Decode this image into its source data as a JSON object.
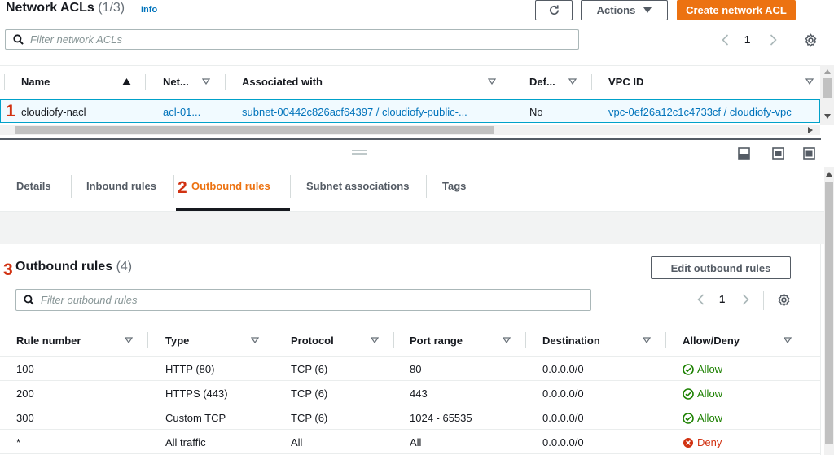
{
  "header": {
    "title": "Network ACLs",
    "count": "(1/3)",
    "info": "Info",
    "actions_label": "Actions",
    "create_label": "Create network ACL"
  },
  "acl_search": {
    "placeholder": "Filter network ACLs"
  },
  "acl_pager": {
    "page": "1"
  },
  "acl_table": {
    "columns": [
      "Name",
      "Net...",
      "Associated with",
      "Def...",
      "VPC ID"
    ],
    "rows": [
      {
        "name": "cloudiofy-nacl",
        "net": "acl-01...",
        "associated": "subnet-00442c826acf64397 / cloudiofy-public-...",
        "default": "No",
        "vpc": "vpc-0ef26a12c1c4733cf / cloudiofy-vpc"
      }
    ]
  },
  "annotations": {
    "one": "1",
    "two": "2",
    "three": "3"
  },
  "tabs": [
    "Details",
    "Inbound rules",
    "Outbound rules",
    "Subnet associations",
    "Tags"
  ],
  "outbound": {
    "title": "Outbound rules",
    "count": "(4)",
    "edit_label": "Edit outbound rules",
    "search_placeholder": "Filter outbound rules",
    "page": "1",
    "columns": [
      "Rule number",
      "Type",
      "Protocol",
      "Port range",
      "Destination",
      "Allow/Deny"
    ],
    "rows": [
      {
        "rule": "100",
        "type": "HTTP (80)",
        "protocol": "TCP (6)",
        "port": "80",
        "dest": "0.0.0.0/0",
        "action": "Allow"
      },
      {
        "rule": "200",
        "type": "HTTPS (443)",
        "protocol": "TCP (6)",
        "port": "443",
        "dest": "0.0.0.0/0",
        "action": "Allow"
      },
      {
        "rule": "300",
        "type": "Custom TCP",
        "protocol": "TCP (6)",
        "port": "1024 - 65535",
        "dest": "0.0.0.0/0",
        "action": "Allow"
      },
      {
        "rule": "*",
        "type": "All traffic",
        "protocol": "All",
        "port": "All",
        "dest": "0.0.0.0/0",
        "action": "Deny"
      }
    ]
  },
  "colors": {
    "accent": "#ec7211",
    "link": "#0073bb",
    "allow": "#1d8102",
    "deny": "#d13212",
    "annotation": "#d13212"
  },
  "icons": [
    "refresh-icon",
    "caret-down-icon",
    "search-icon",
    "chevron-left-icon",
    "chevron-right-icon",
    "settings-icon",
    "sort-asc-icon",
    "sort-desc-icon",
    "drag-handle-icon",
    "split-bottom-icon",
    "split-side-icon",
    "split-full-icon",
    "check-circle-icon",
    "x-circle-icon"
  ]
}
